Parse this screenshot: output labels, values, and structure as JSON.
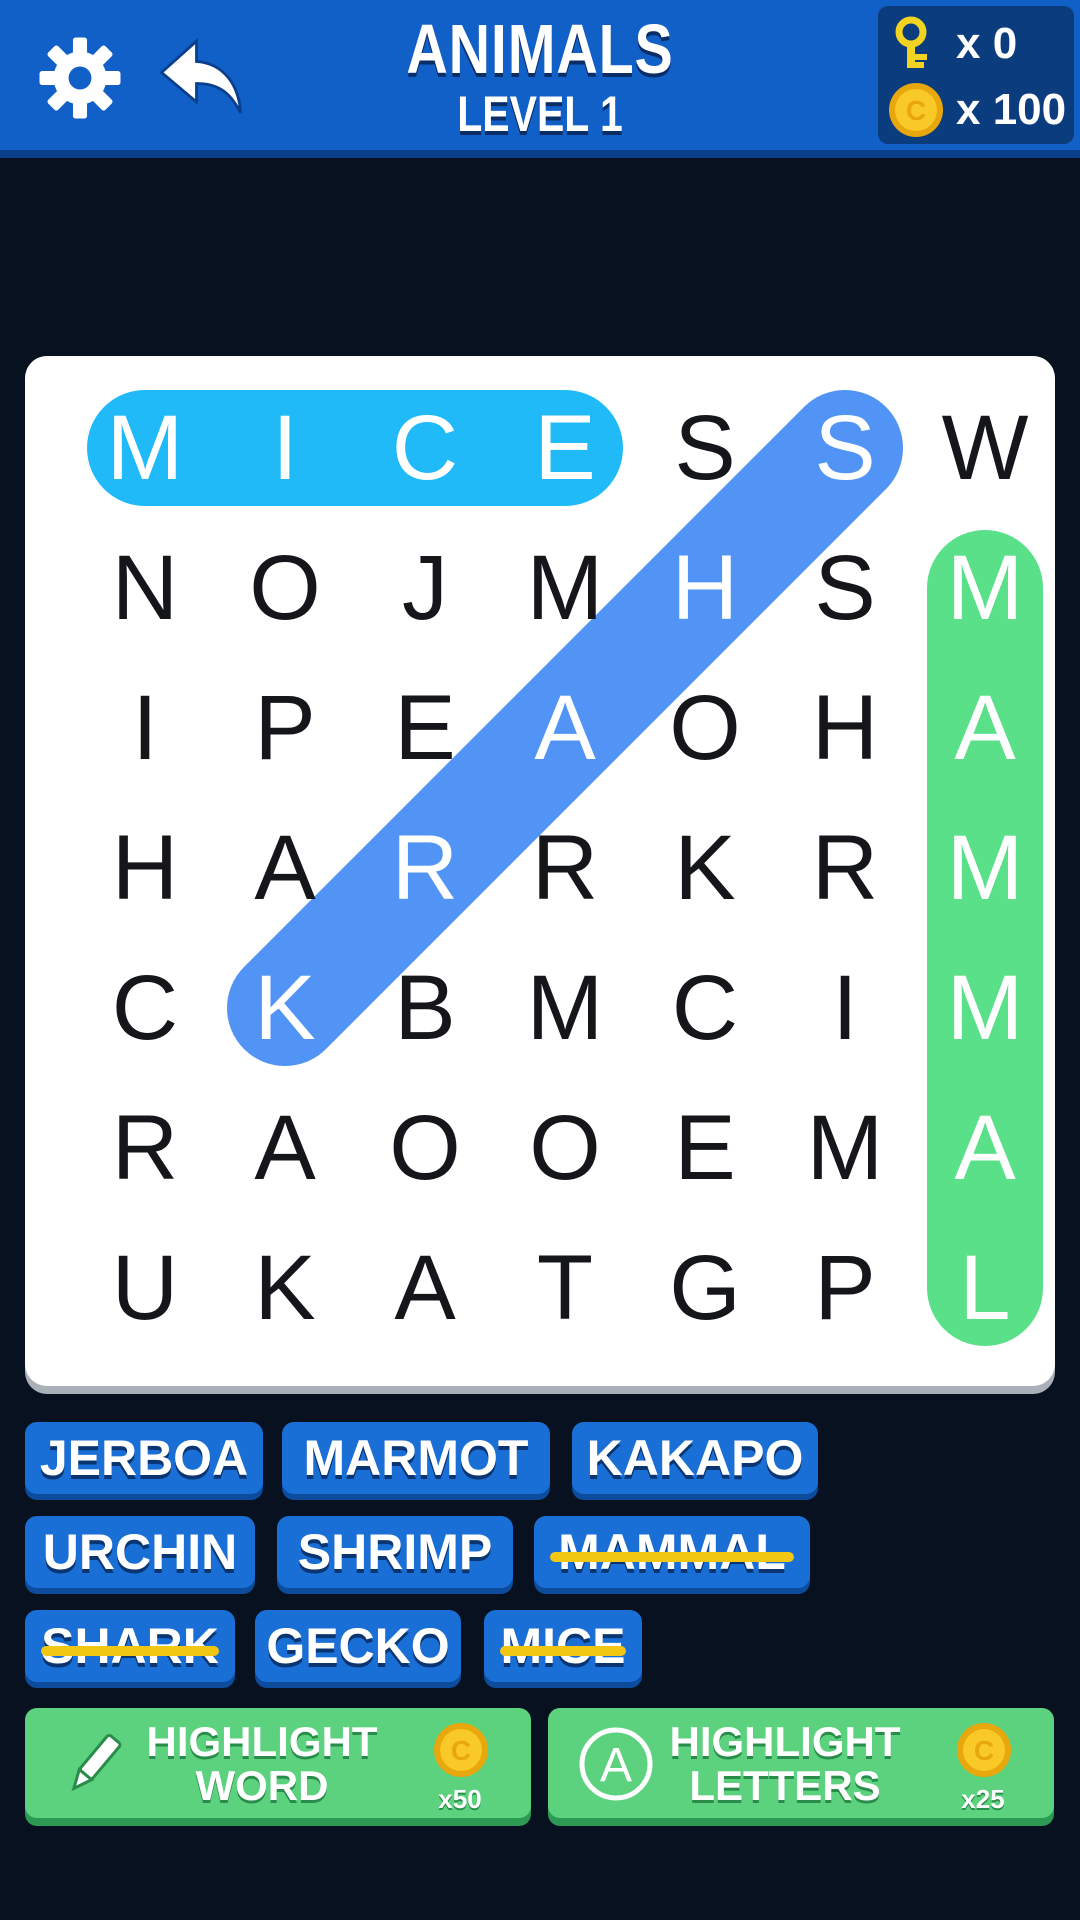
{
  "header": {
    "title": "ANIMALS",
    "level": "LEVEL 1",
    "keys": "x 0",
    "coins": "x 100"
  },
  "icons": {
    "settings": "gear-icon",
    "back": "back-arrow-icon",
    "key": "key-icon",
    "coin": "coin-icon",
    "pencil": "pencil-icon",
    "letter_a": "letter-a-icon"
  },
  "colors": {
    "header": "#1160c8",
    "background": "#07111f",
    "highlight_light_blue": "#1fbaf7",
    "highlight_blue": "#5294f5",
    "highlight_green": "#5be08a",
    "chip": "#1a6fd6",
    "strike": "#f2c714",
    "power_button": "#5cd27e"
  },
  "grid": {
    "rows": [
      [
        "M",
        "I",
        "C",
        "E",
        "S",
        "S",
        "W"
      ],
      [
        "N",
        "O",
        "J",
        "M",
        "H",
        "S",
        "M"
      ],
      [
        "I",
        "P",
        "E",
        "A",
        "O",
        "H",
        "A"
      ],
      [
        "H",
        "A",
        "R",
        "R",
        "K",
        "R",
        "M"
      ],
      [
        "C",
        "K",
        "B",
        "M",
        "C",
        "I",
        "M"
      ],
      [
        "R",
        "A",
        "O",
        "O",
        "E",
        "M",
        "A"
      ],
      [
        "U",
        "K",
        "A",
        "T",
        "G",
        "P",
        "L"
      ]
    ],
    "found_cells": [
      [
        0,
        0
      ],
      [
        0,
        1
      ],
      [
        0,
        2
      ],
      [
        0,
        3
      ],
      [
        0,
        5
      ],
      [
        1,
        4
      ],
      [
        2,
        3
      ],
      [
        3,
        2
      ],
      [
        4,
        1
      ],
      [
        1,
        6
      ],
      [
        2,
        6
      ],
      [
        3,
        6
      ],
      [
        4,
        6
      ],
      [
        5,
        6
      ],
      [
        6,
        6
      ]
    ],
    "found_words": [
      {
        "word": "MICE",
        "color": "#1fbaf7",
        "from": [
          0,
          0
        ],
        "to": [
          0,
          3
        ]
      },
      {
        "word": "SHARK",
        "color": "#5294f5",
        "from": [
          0,
          5
        ],
        "to": [
          4,
          1
        ]
      },
      {
        "word": "MAMMAL",
        "color": "#5be08a",
        "from": [
          1,
          6
        ],
        "to": [
          6,
          6
        ]
      }
    ]
  },
  "words": [
    {
      "label": "JERBOA",
      "found": false
    },
    {
      "label": "MARMOT",
      "found": false
    },
    {
      "label": "KAKAPO",
      "found": false
    },
    {
      "label": "URCHIN",
      "found": false
    },
    {
      "label": "SHRIMP",
      "found": false
    },
    {
      "label": "MAMMAL",
      "found": true
    },
    {
      "label": "SHARK",
      "found": true
    },
    {
      "label": "GECKO",
      "found": false
    },
    {
      "label": "MICE",
      "found": true
    }
  ],
  "powerups": {
    "highlight_word": {
      "line1": "HIGHLIGHT",
      "line2": "WORD",
      "cost": "x50"
    },
    "highlight_letters": {
      "line1": "HIGHLIGHT",
      "line2": "LETTERS",
      "cost": "x25"
    }
  }
}
